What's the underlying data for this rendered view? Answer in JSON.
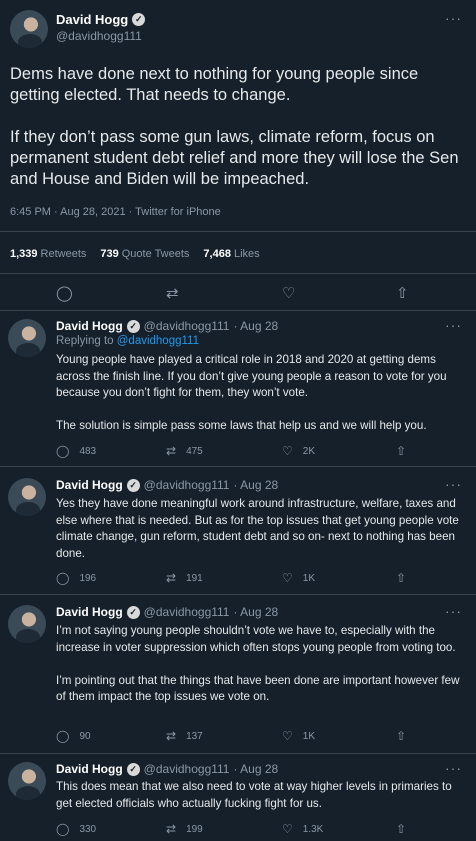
{
  "main_tweet": {
    "name": "David Hogg",
    "handle": "@davidhogg111",
    "text": "Dems have done next to nothing for young people since getting elected. That needs to change.\n\nIf they don’t pass some gun laws, climate reform, focus on permanent student debt relief and more they will lose the Sen and House and Biden will be impeached.",
    "meta": "6:45 PM · Aug 28, 2021 · Twitter for iPhone",
    "retweets": "1,339",
    "retweets_label": "Retweets",
    "quotes": "739",
    "quotes_label": "Quote Tweets",
    "likes": "7,468",
    "likes_label": "Likes"
  },
  "replies": [
    {
      "name": "David Hogg",
      "handle": "@davidhogg111",
      "date": "· Aug 28",
      "replying_prefix": "Replying to",
      "replying_to": "@davidhogg111",
      "text": "Young people have played a critical role in 2018 and 2020 at getting dems across the finish line. If you don’t give young people a reason to vote for you because you don’t fight for them, they won’t vote.\n\nThe solution is simple pass some laws that help us and we will help you.",
      "replies": "483",
      "retweets": "475",
      "likes": "2K"
    },
    {
      "name": "David Hogg",
      "handle": "@davidhogg111",
      "date": "· Aug 28",
      "text": "Yes they have done meaningful work around infrastructure, welfare, taxes and else where that is needed. But as for the top issues that get young people vote climate change, gun reform, student debt and so on- next to nothing has been done.",
      "replies": "196",
      "retweets": "191",
      "likes": "1K"
    },
    {
      "name": "David Hogg",
      "handle": "@davidhogg111",
      "date": "· Aug 28",
      "text": "I’m not saying young people shouldn’t vote we have to, especially with the increase in voter suppression which often stops young people from voting too.\n\nI’m pointing out that the things that have been done are important however few of them impact the top issues we vote on.",
      "replies": "90",
      "retweets": "137",
      "likes": "1K"
    },
    {
      "name": "David Hogg",
      "handle": "@davidhogg111",
      "date": "· Aug 28",
      "text": "This does mean that we also need to vote at way higher levels in primaries to get elected officials who actually fucking fight for us.",
      "replies": "330",
      "retweets": "199",
      "likes": "1.3K"
    }
  ],
  "icons": {
    "reply": "reply-icon",
    "retweet": "retweet-icon",
    "like": "heart-icon",
    "share": "share-icon",
    "verified": "verified-badge-icon",
    "more": "more-icon"
  },
  "colors": {
    "background": "#15202b",
    "link": "#1d9bf0",
    "muted": "#8b98a5",
    "divider": "#38444d"
  }
}
